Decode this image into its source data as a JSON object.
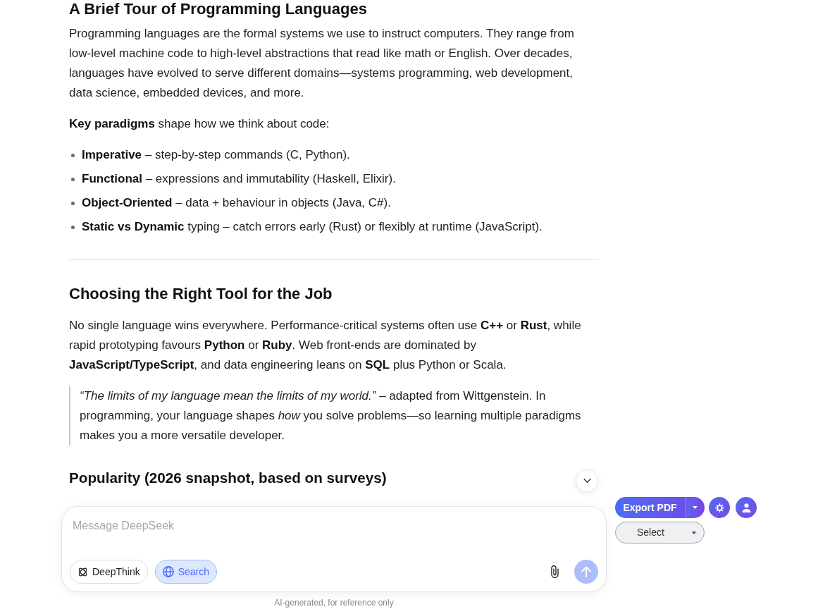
{
  "article": {
    "blocks": [
      {
        "kind": "title",
        "text": "A Brief Tour of Programming Languages"
      },
      {
        "kind": "paragraph",
        "text": "Programming languages are the formal systems we use to instruct computers. They range from low-level machine code to high-level abstractions that read like math or English. Over decades, languages have evolved to serve different domains—systems programming, web development, data science, embedded devices, and more."
      },
      {
        "kind": "paragraph",
        "text": "**Key paradigms** shape how we think about code:"
      },
      {
        "kind": "list",
        "items": [
          "**Imperative** – step-by-step commands (C, Python).",
          "**Functional** – expressions and immutability (Haskell, Elixir).",
          "**Object-Oriented** – data + behaviour in objects (Java, C#).",
          "**Static vs Dynamic** typing – catch errors early (Rust) or flexibly at runtime (JavaScript)."
        ]
      },
      {
        "kind": "divider"
      },
      {
        "kind": "heading",
        "text": "Choosing the Right Tool for the Job"
      },
      {
        "kind": "paragraph",
        "text": "No single language wins everywhere. Performance-critical systems often use **C++** or **Rust**, while rapid prototyping favours **Python** or **Ruby**. Web front-ends are dominated by **JavaScript/TypeScript**, and data engineering leans on **SQL** plus Python or Scala."
      },
      {
        "kind": "quote",
        "text": "*“The limits of my language mean the limits of my world.”* – adapted from Wittgenstein. In programming, your language shapes *how* you solve problems—so learning multiple paradigms makes you a more versatile developer."
      },
      {
        "kind": "subheading",
        "text": "Popularity (2026 snapshot, based on surveys)"
      }
    ]
  },
  "composer": {
    "placeholder": "Message DeepSeek",
    "toggles": [
      {
        "kind": "deepthink",
        "label": "DeepThink",
        "selected": false
      },
      {
        "kind": "search",
        "label": "Search",
        "selected": true
      }
    ],
    "send": {
      "disabled": true
    }
  },
  "disclaimer": "AI-generated, for reference only",
  "toolbar": {
    "export_label": "Export PDF",
    "select": {
      "value": "Select"
    }
  }
}
